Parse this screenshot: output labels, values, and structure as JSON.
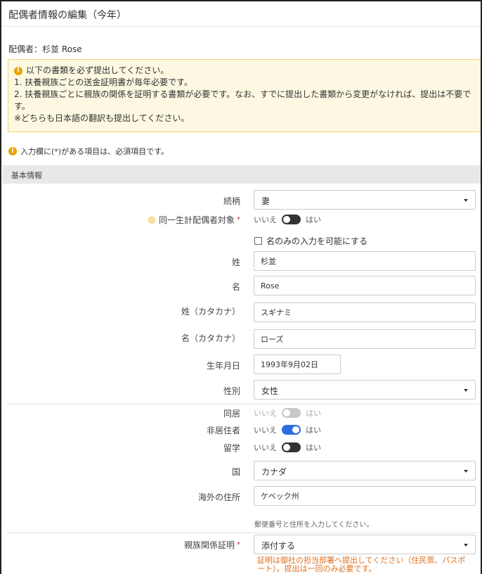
{
  "header": {
    "title": "配偶者情報の編集（今年）"
  },
  "spouse_line": "配偶者：杉並 Rose",
  "notice": {
    "lead": "以下の書類を必ず提出してください。",
    "lines": [
      "1. 扶養親族ごとの送金証明書が毎年必要です。",
      "2. 扶養親族ごとに親族の関係を証明する書類が必要です。なお、すでに提出した書類から変更がなければ、提出は不要で",
      "す。",
      "※どちらも日本語の翻訳も提出してください。"
    ]
  },
  "required_note": "入力欄に(*)がある項目は、必須項目です。",
  "section_title": "基本情報",
  "form": {
    "relation": {
      "label": "続柄",
      "value": "妻"
    },
    "same_household": {
      "label": "同一生計配偶者対象",
      "required_mark": "*",
      "off_label": "いいえ",
      "on_label": "はい",
      "state": "off"
    },
    "name_only_checkbox": {
      "label": "名のみの入力を可能にする",
      "checked": false
    },
    "last_name": {
      "label": "姓",
      "value": "杉並"
    },
    "first_name": {
      "label": "名",
      "value": "Rose"
    },
    "last_name_kana": {
      "label": "姓（カタカナ）",
      "value": "スギナミ"
    },
    "first_name_kana": {
      "label": "名（カタカナ）",
      "value": "ローズ"
    },
    "birth_date": {
      "label": "生年月日",
      "value": "1993年9月02日"
    },
    "gender": {
      "label": "性別",
      "value": "女性"
    },
    "cohabiting": {
      "label": "同居",
      "off_label": "いいえ",
      "on_label": "はい",
      "state": "disabled"
    },
    "non_resident": {
      "label": "非居住者",
      "off_label": "いいえ",
      "on_label": "はい",
      "state": "on"
    },
    "study_abroad": {
      "label": "留学",
      "off_label": "いいえ",
      "on_label": "はい",
      "state": "off"
    },
    "country": {
      "label": "国",
      "value": "カナダ"
    },
    "overseas_address": {
      "label": "海外の住所",
      "value": "ケベック州",
      "hint": "郵便番号と住所を入力してください。"
    },
    "relation_proof": {
      "label": "親族関係証明",
      "required_mark": "*",
      "value": "添付する",
      "warning": "証明は御社の担当部署へ提出してください（住民票、パスポート）。提出は一回のみ必要です。"
    }
  },
  "colors": {
    "toggle_on": "#2b6de0",
    "toggle_off": "#333333",
    "notice_bg": "#fdf8e1",
    "warning_text": "#e06f1f",
    "required_mark": "#d9302c"
  }
}
